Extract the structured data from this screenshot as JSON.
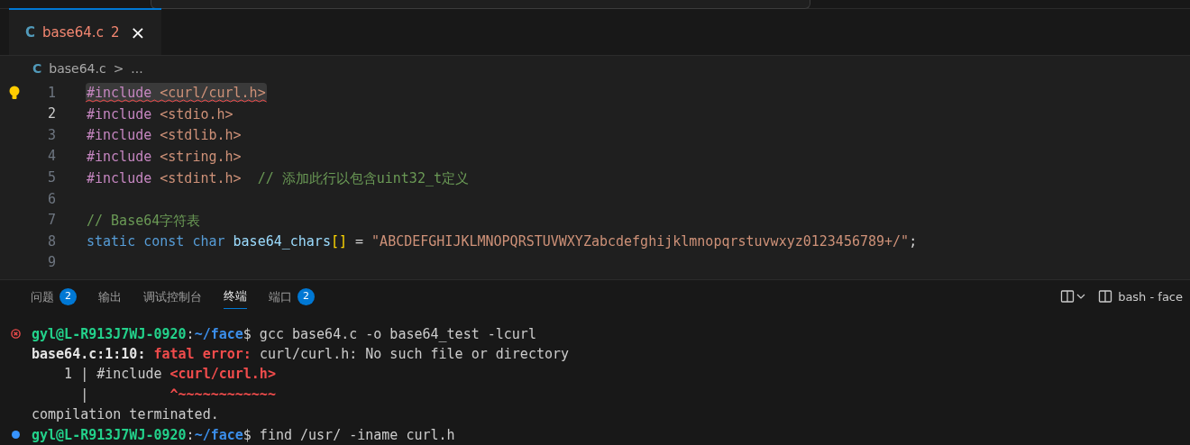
{
  "editor_tabs": [
    {
      "icon": "C",
      "label": "base64.c",
      "problems": "2",
      "close": "×",
      "selected": true
    }
  ],
  "breadcrumb": {
    "icon": "C",
    "file": "base64.c",
    "separator": ">",
    "rest": "..."
  },
  "code": {
    "lines": [
      {
        "number": "1",
        "active": false,
        "highlighted": true,
        "lightbulb": true,
        "error": true,
        "tokens": [
          {
            "kind": "directive",
            "text": "#include "
          },
          {
            "kind": "string",
            "text": "<curl/curl.h>"
          }
        ]
      },
      {
        "number": "2",
        "active": true,
        "highlighted": false,
        "lightbulb": false,
        "error": false,
        "tokens": [
          {
            "kind": "directive",
            "text": "#include "
          },
          {
            "kind": "string",
            "text": "<stdio.h>"
          }
        ]
      },
      {
        "number": "3",
        "active": false,
        "highlighted": false,
        "lightbulb": false,
        "error": false,
        "tokens": [
          {
            "kind": "directive",
            "text": "#include "
          },
          {
            "kind": "string",
            "text": "<stdlib.h>"
          }
        ]
      },
      {
        "number": "4",
        "active": false,
        "highlighted": false,
        "lightbulb": false,
        "error": false,
        "tokens": [
          {
            "kind": "directive",
            "text": "#include "
          },
          {
            "kind": "string",
            "text": "<string.h>"
          }
        ]
      },
      {
        "number": "5",
        "active": false,
        "highlighted": false,
        "lightbulb": false,
        "error": false,
        "tokens": [
          {
            "kind": "directive",
            "text": "#include "
          },
          {
            "kind": "string",
            "text": "<stdint.h>  "
          },
          {
            "kind": "comment",
            "text": "// 添加此行以包含uint32_t定义"
          }
        ]
      },
      {
        "number": "6",
        "active": false,
        "highlighted": false,
        "lightbulb": false,
        "error": false
      },
      {
        "number": "7",
        "active": false,
        "highlighted": false,
        "lightbulb": false,
        "error": false,
        "tokens": [
          {
            "kind": "comment",
            "text": "// Base64字符表"
          }
        ]
      },
      {
        "number": "8",
        "active": false,
        "highlighted": false,
        "lightbulb": false,
        "error": false,
        "tokens": [
          {
            "kind": "keyword",
            "text": "static const char "
          },
          {
            "kind": "ident",
            "text": "base64_chars"
          },
          {
            "kind": "bracket",
            "text": "[]"
          },
          {
            "kind": "plain",
            "text": " = "
          },
          {
            "kind": "string",
            "text": "\"ABCDEFGHIJKLMNOPQRSTUVWXYZabcdefghijklmnopqrstuvwxyz0123456789+/\""
          },
          {
            "kind": "plain",
            "text": ";"
          }
        ]
      },
      {
        "number": "9",
        "active": false,
        "highlighted": false,
        "lightbulb": false,
        "error": false
      }
    ]
  },
  "panel": {
    "tabs": [
      {
        "label": "问题",
        "badge": "2",
        "selected": false
      },
      {
        "label": "输出",
        "selected": false
      },
      {
        "label": "调试控制台",
        "selected": false
      },
      {
        "label": "终端",
        "selected": true
      },
      {
        "label": "端口",
        "badge": "2",
        "selected": false
      }
    ],
    "terminal_name": "bash - face"
  },
  "terminal": {
    "lines": [
      {
        "failed": true,
        "running": false,
        "tokens": [
          {
            "kind": "user",
            "text": "gyl@L-R913J7WJ-0920"
          },
          {
            "kind": "plain",
            "text": ":"
          },
          {
            "kind": "path",
            "text": "~/face"
          },
          {
            "kind": "plain",
            "text": "$ gcc base64.c -o base64_test -lcurl"
          }
        ]
      },
      {
        "failed": false,
        "running": false,
        "tokens": [
          {
            "kind": "bold",
            "text": "base64.c:1:10: "
          },
          {
            "kind": "error",
            "text": "fatal error: "
          },
          {
            "kind": "plain",
            "text": "curl/curl.h: No such file or directory"
          }
        ]
      },
      {
        "failed": false,
        "running": false,
        "tokens": [
          {
            "kind": "plain",
            "text": "    1 | #include "
          },
          {
            "kind": "error",
            "text": "<curl/curl.h>"
          }
        ]
      },
      {
        "failed": false,
        "running": false,
        "tokens": [
          {
            "kind": "plain",
            "text": "      |          "
          },
          {
            "kind": "error",
            "text": "^~~~~~~~~~~~~"
          }
        ]
      },
      {
        "failed": false,
        "running": false,
        "tokens": [
          {
            "kind": "plain",
            "text": "compilation terminated."
          }
        ]
      },
      {
        "failed": false,
        "running": true,
        "tokens": [
          {
            "kind": "user",
            "text": "gyl@L-R913J7WJ-0920"
          },
          {
            "kind": "plain",
            "text": ":"
          },
          {
            "kind": "path",
            "text": "~/face"
          },
          {
            "kind": "plain",
            "text": "$ find /usr/ -iname curl.h"
          }
        ]
      }
    ]
  }
}
